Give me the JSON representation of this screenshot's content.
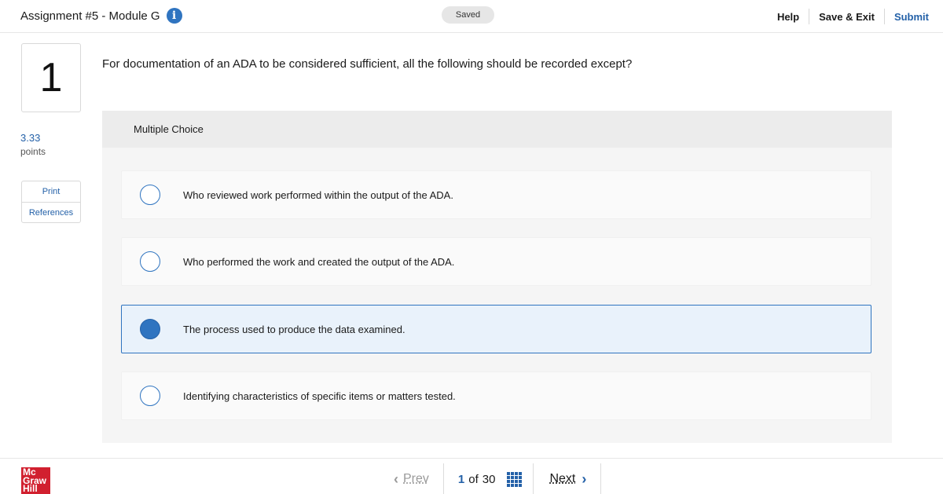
{
  "header": {
    "title": "Assignment #5 - Module G",
    "info_icon": "i",
    "saved_status": "Saved",
    "help": "Help",
    "save_exit": "Save & Exit",
    "submit": "Submit"
  },
  "sidebar": {
    "question_number": "1",
    "points_value": "3.33",
    "points_label": "points",
    "links": [
      "Print",
      "References"
    ]
  },
  "question": {
    "text": "For documentation of an ADA to be considered sufficient, all the following should be recorded except?",
    "type_label": "Multiple Choice",
    "options": [
      {
        "text": "Who reviewed work performed within the output of the ADA.",
        "selected": false
      },
      {
        "text": "Who performed the work and created the output of the ADA.",
        "selected": false
      },
      {
        "text": "The process used to produce the data examined.",
        "selected": true
      },
      {
        "text": "Identifying characteristics of specific items or matters tested.",
        "selected": false
      }
    ]
  },
  "footer": {
    "logo_lines": [
      "Mc",
      "Graw",
      "Hill"
    ],
    "prev_label": "Prev",
    "current_page": "1",
    "of_label": "of",
    "total_pages": "30",
    "next_label": "Next",
    "prev_icon": "chevron-left-icon",
    "next_icon": "chevron-right-icon",
    "grid_icon": "question-grid-icon"
  },
  "colors": {
    "accent": "#2f74c0",
    "link": "#2461a8",
    "logo_red": "#d1202f",
    "panel_bg": "#f5f5f5"
  }
}
